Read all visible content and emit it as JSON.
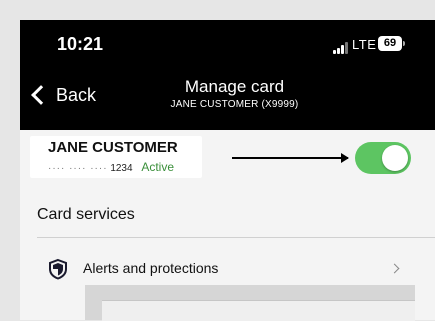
{
  "status_bar": {
    "time": "10:21",
    "network": "LTE",
    "battery": "69"
  },
  "nav": {
    "back_label": "Back",
    "title": "Manage card",
    "subtitle": "JANE CUSTOMER (X9999)"
  },
  "card": {
    "holder": "JANE CUSTOMER",
    "masked_dots": "···· ···· ····",
    "last4": "1234",
    "status": "Active",
    "toggle_on": true
  },
  "card_services": {
    "heading": "Card services",
    "items": [
      {
        "label": "Alerts and protections",
        "icon": "shield-icon"
      }
    ]
  },
  "colors": {
    "toggle_on": "#5dc562",
    "status_active": "#3a8f3a"
  }
}
